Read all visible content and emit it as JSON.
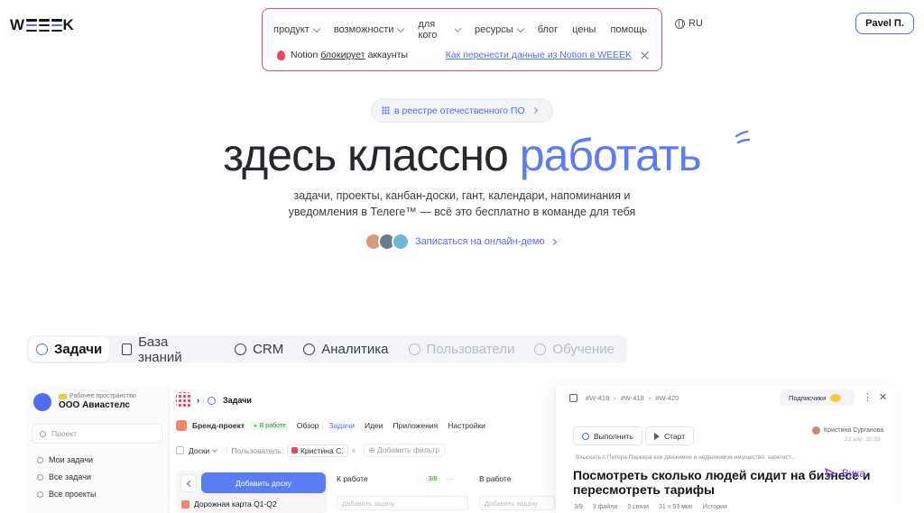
{
  "header": {
    "logo_text": "WEEEK",
    "nav": [
      {
        "label": "продукт",
        "dropdown": true
      },
      {
        "label": "возможности",
        "dropdown": true
      },
      {
        "label": "для кого",
        "dropdown": true
      },
      {
        "label": "ресурсы",
        "dropdown": true
      },
      {
        "label": "блог",
        "dropdown": false
      },
      {
        "label": "цены",
        "dropdown": false
      },
      {
        "label": "помощь",
        "dropdown": false
      }
    ],
    "notice": {
      "prefix": "Notion",
      "highlight": "блокирует",
      "suffix": "аккаунты",
      "link": "Как перенести данные из Notion в WEEEK"
    },
    "language": "RU",
    "user_button": "Pavel П."
  },
  "hero": {
    "registry_pill": "в реестре отечественного ПО",
    "title_main": "здесь классно",
    "title_accent": "работать",
    "subtitle_line1": "задачи, проекты, канбан-доски, гант, календари, напоминания и",
    "subtitle_line2": "уведомления в Телеге™ — всё это бесплатно в команде для тебя",
    "demo_link": "Записаться на онлайн-демо"
  },
  "feature_tabs": [
    {
      "label": "Задачи",
      "state": "active"
    },
    {
      "label": "База знаний",
      "state": "normal"
    },
    {
      "label": "CRM",
      "state": "normal"
    },
    {
      "label": "Аналитика",
      "state": "normal"
    },
    {
      "label": "Пользователи",
      "state": "disabled"
    },
    {
      "label": "Обучение",
      "state": "disabled"
    }
  ],
  "app_preview": {
    "sidebar": {
      "workspace_badge": "Рабочее пространство",
      "workspace_name": "ООО Авиастелс",
      "search_placeholder": "Проект",
      "items": [
        "Мои задачи",
        "Все задачи",
        "Все проекты"
      ]
    },
    "main": {
      "breadcrumb": "Задачи",
      "project_name": "Бренд-проект",
      "project_status": "В работе",
      "project_tabs": [
        "Обзор",
        "Задачи",
        "Идеи",
        "Приложения",
        "Настройки"
      ],
      "active_project_tab": "Задачи",
      "view_selector": "Доски",
      "filter_label": "Пользователь:",
      "filter_user": "Кристина С.",
      "add_filter": "Добавить фильтр",
      "add_board": "Добавить доску",
      "board_card": "Дорожная карта Q1-Q2",
      "columns": [
        {
          "title": "К работе",
          "count": "3/8",
          "add_task": "Добавить задачу"
        },
        {
          "title": "В работе",
          "count": "",
          "add_task": "Добавить задачу"
        }
      ]
    },
    "task_panel": {
      "ids": [
        "#W-418",
        "#W-419",
        "#W-420"
      ],
      "subscribers": "Подписчики",
      "complete_button": "Выполнить",
      "start_button": "Старт",
      "author": "Кристина Сурганова",
      "author_date": "23 апр. 20:33",
      "parent_task": "Взыскать с Питера Паркера все движимое и недвижимое имущество, зарегист...",
      "title": "Посмотреть сколько людей сидит на бизнесе и пересмотреть тарифы",
      "meta": [
        "3/9",
        "3 файла",
        "3 связи",
        "31 ч 53 мин",
        "История"
      ]
    },
    "cursor_label": "Вика"
  },
  "colors": {
    "accent": "#5b7cf5",
    "notice_border": "#e8475d",
    "cursor": "#7b3cf0"
  }
}
